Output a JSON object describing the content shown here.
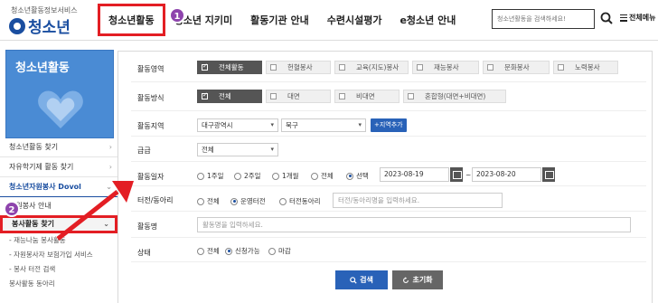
{
  "header": {
    "logo_top": "청소년활동정보서비스",
    "logo_text": "청소년",
    "nav": [
      "청소년활동",
      "청소년 지키미",
      "활동기관 안내",
      "수련시설평가",
      "e청소년 안내"
    ],
    "search_placeholder": "청소년활동을 검색하세요!",
    "menu_all": "전체메뉴"
  },
  "badges": [
    "1",
    "2"
  ],
  "sidebar": {
    "banner_title": "청소년활동",
    "items": [
      "청소년활동 찾기",
      "자유학기제 활동 찾기"
    ],
    "group": "청소년자원봉사 Dovol",
    "sub_items": [
      "자원봉사 안내",
      "봉사활동 찾기"
    ],
    "subsub_items": [
      "- 재능나눔 봉사활동",
      "- 자원봉사자 보험가입 서비스",
      "- 봉사 터전 검색",
      "봉사활동 동아리"
    ]
  },
  "form": {
    "labels": [
      "활동영역",
      "활동방식",
      "활동지역",
      "급급",
      "활동일자",
      "터전/동아리",
      "활동명",
      "상태"
    ],
    "area_options": [
      "전체활동",
      "헌혈봉사",
      "교육(지도)봉사",
      "재능봉사",
      "문화봉사",
      "노력봉사"
    ],
    "method_options": [
      "전체",
      "대면",
      "비대면",
      "혼합형(대면+비대면)"
    ],
    "region_city": "대구광역시",
    "region_district": "북구",
    "region_add": "+지역추가",
    "grade": "전체",
    "date_options": [
      "1주일",
      "2주일",
      "1개월",
      "전체",
      "선택"
    ],
    "date_from": "2023-08-19",
    "date_to": "2023-08-20",
    "date_sep": "~",
    "base_options": [
      "전체",
      "운영터전",
      "터전동아리"
    ],
    "base_placeholder": "터전/동아리명을 입력하세요.",
    "name_placeholder": "활동명을 입력하세요.",
    "status_options": [
      "전체",
      "신청가능",
      "마감"
    ],
    "search_button": "검색",
    "reset_button": "초기화"
  },
  "colors": {
    "accent": "#2962b8",
    "highlight": "#e31e24",
    "badge": "#8e44ad"
  }
}
